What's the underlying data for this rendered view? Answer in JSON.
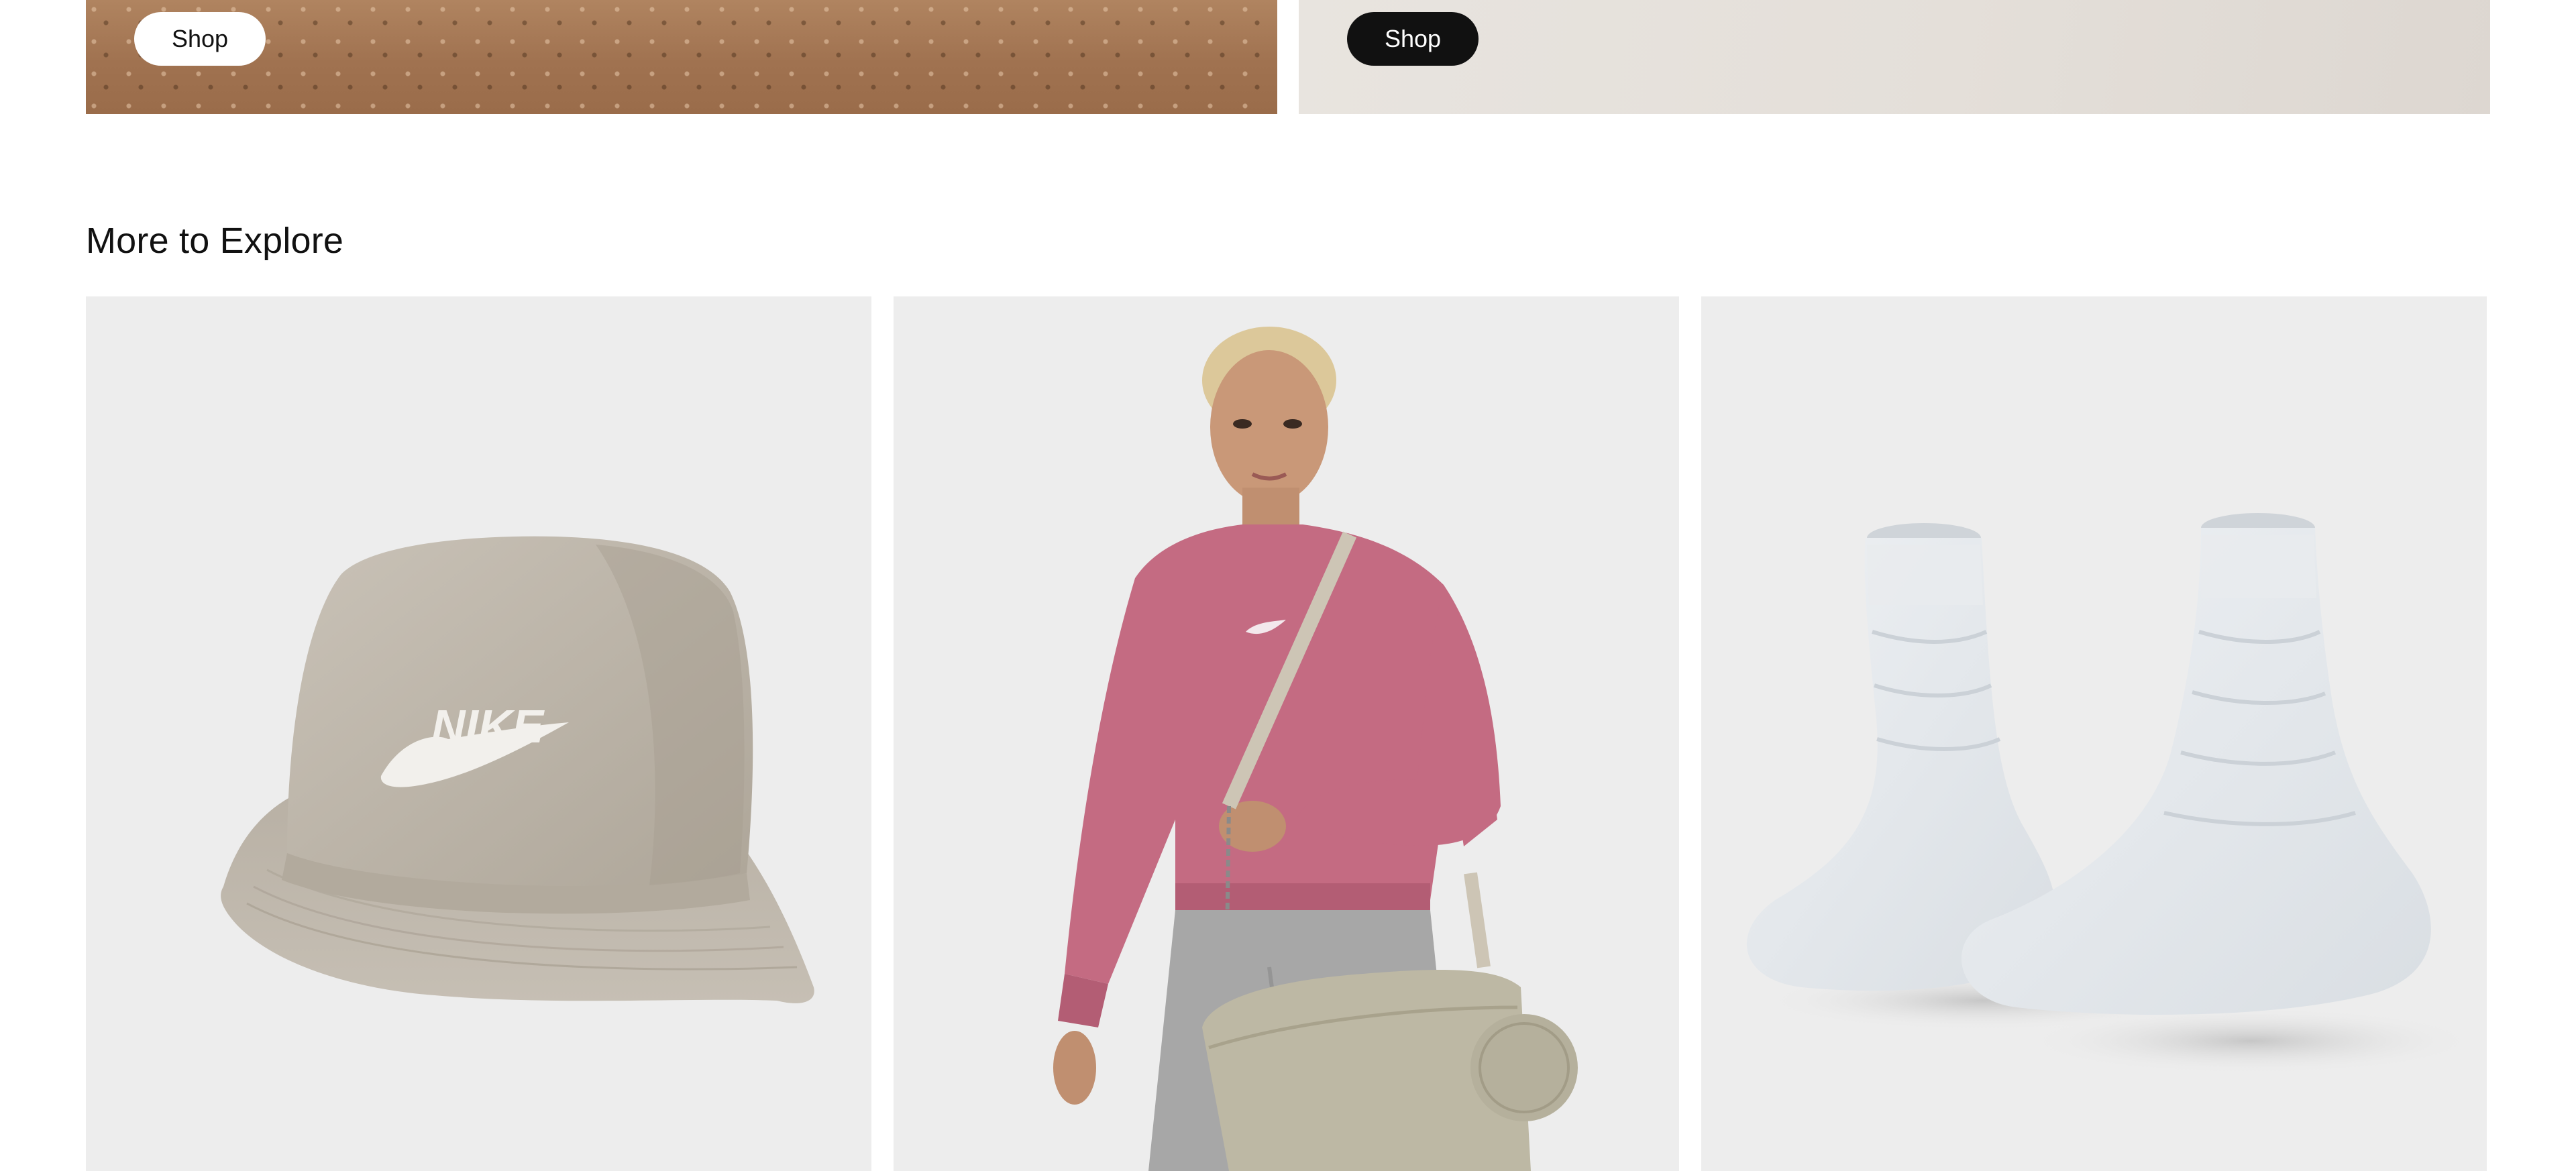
{
  "hero": {
    "left": {
      "button_label": "Shop"
    },
    "right": {
      "button_label": "Shop"
    }
  },
  "explore": {
    "title": "More to Explore",
    "cards": [
      {
        "image": "bucket-hat",
        "logo_text": "NIKE"
      },
      {
        "image": "model-pink-sweatshirt-tote-bag"
      },
      {
        "image": "white-socks"
      }
    ]
  },
  "colors": {
    "card_bg": "#ededed",
    "button_dark": "#111111",
    "button_light": "#ffffff",
    "sweatshirt": "#c46b82",
    "hat": "#bcb5aa",
    "bag": "#bdb8a4"
  }
}
